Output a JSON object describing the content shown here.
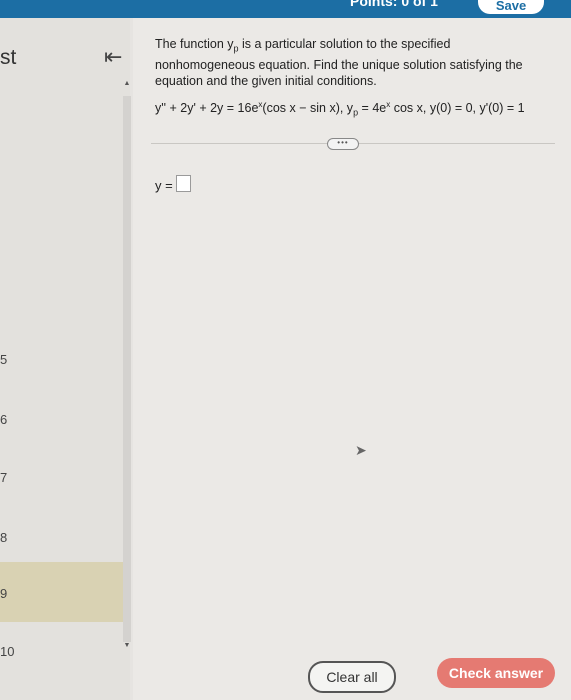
{
  "header": {
    "points_text": "Points: 0 of 1",
    "save_label": "Save"
  },
  "sidebar": {
    "title_fragment": "st",
    "collapse_icon": "⇤",
    "numbers": [
      "5",
      "6",
      "7",
      "8",
      "9",
      "10"
    ]
  },
  "question": {
    "prompt_a": "The function y",
    "prompt_sub": "p",
    "prompt_b": " is a particular solution to the specified nonhomogeneous equation. Find the unique solution satisfying the equation and the given initial conditions.",
    "eq_lhs": "y'' + 2y' + 2y = 16e",
    "eq_exp": "x",
    "eq_paren": "(cos x − sin x), y",
    "eq_p": "p",
    "eq_yp": " = 4e",
    "eq_exp2": "x",
    "eq_rest": " cos x, y(0) = 0, y'(0) = 1",
    "more_label": "•••",
    "answer_label": "y ="
  },
  "footer": {
    "clear_label": "Clear all",
    "check_label": "Check answer"
  }
}
